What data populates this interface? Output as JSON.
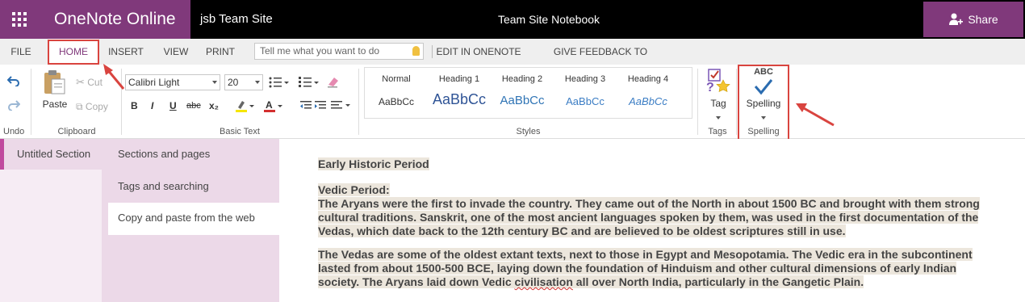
{
  "app": {
    "brand": "OneNote Online",
    "site_name": "jsb Team Site",
    "notebook_title": "Team Site Notebook",
    "share_label": "Share"
  },
  "tabs": [
    "FILE",
    "HOME",
    "INSERT",
    "VIEW",
    "PRINT"
  ],
  "active_tab": "HOME",
  "tell_me": {
    "placeholder": "Tell me what you want to do"
  },
  "extra_tabs": [
    "EDIT IN ONENOTE",
    "GIVE FEEDBACK TO MICROSOFT"
  ],
  "ribbon": {
    "groups": {
      "undo": "Undo",
      "clipboard": "Clipboard",
      "basic_text": "Basic Text",
      "styles": "Styles",
      "tags": "Tags",
      "spelling": "Spelling"
    },
    "clipboard": {
      "paste": "Paste",
      "cut": "Cut",
      "copy": "Copy"
    },
    "font": {
      "family": "Calibri Light",
      "size": "20"
    },
    "format_buttons": [
      "B",
      "I",
      "U",
      "abc",
      "x₂"
    ],
    "styles": [
      {
        "name": "Normal",
        "sample": "AaBbCc"
      },
      {
        "name": "Heading 1",
        "sample": "AaBbCc"
      },
      {
        "name": "Heading 2",
        "sample": "AaBbCc"
      },
      {
        "name": "Heading 3",
        "sample": "AaBbCc"
      },
      {
        "name": "Heading 4",
        "sample": "AaBbCc"
      }
    ],
    "tag_label": "Tag",
    "spelling_label": "Spelling",
    "spelling_icon_text": "ABC"
  },
  "sections": [
    {
      "label": "Untitled Section",
      "active": true
    }
  ],
  "pages": [
    {
      "label": "Sections and pages",
      "active": false
    },
    {
      "label": "Tags and searching",
      "active": false
    },
    {
      "label": "Copy and paste from the web",
      "active": true
    }
  ],
  "content": {
    "heading": "Early Historic Period",
    "subheading": "Vedic Period:",
    "para1_lines": [
      "The Aryans were the first to invade the country. They came out of the North in about 1500 BC and brought with them strong",
      "cultural traditions. Sanskrit, one of the most ancient languages spoken by them, was used in the first documentation of the",
      "Vedas, which date back to the 12th century BC and are believed to be oldest scriptures still in use."
    ],
    "para2_lines": [
      "The Vedas are some of the oldest extant texts, next to those in Egypt and Mesopotamia. The Vedic era in the subcontinent",
      "lasted from about 1500-500 BCE, laying down the foundation of Hinduism and other cultural dimensions of early Indian"
    ],
    "para2_last": {
      "before": "society. The Aryans laid down Vedic ",
      "misspelled": "civilisation",
      "after": " all over North India, particularly in the Gangetic Plain."
    }
  },
  "colors": {
    "brand_purple": "#80397b",
    "annotation_red": "#d9443f",
    "section_accent": "#c04a9e",
    "highlight_bg": "#ece6dc"
  }
}
